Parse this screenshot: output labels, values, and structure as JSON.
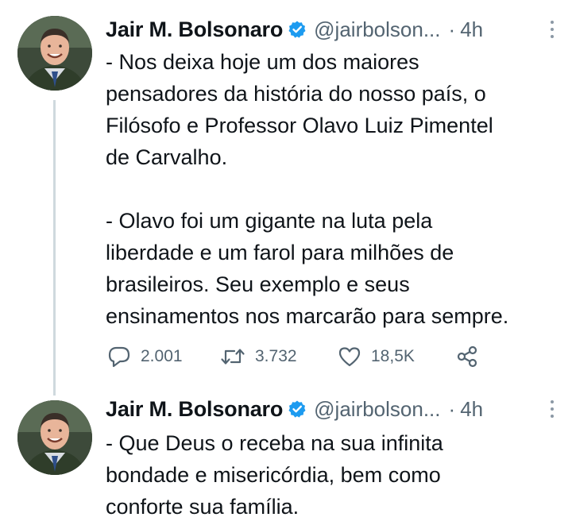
{
  "tweets": [
    {
      "display_name": "Jair M. Bolsonaro",
      "handle": "@jairbolson...",
      "separator": "·",
      "time": "4h",
      "paragraphs": [
        [
          "- Nos deixa hoje um dos maiores",
          "pensadores da história do nosso país, o",
          "Filósofo e Professor Olavo Luiz Pimentel",
          "de Carvalho."
        ],
        [
          "- Olavo foi um gigante na luta pela",
          "liberdade e um farol para milhões de",
          "brasileiros. Seu exemplo e seus",
          "ensinamentos nos marcarão para sempre."
        ]
      ],
      "actions": {
        "replies": "2.001",
        "retweets": "3.732",
        "likes": "18,5K"
      }
    },
    {
      "display_name": "Jair M. Bolsonaro",
      "handle": "@jairbolson...",
      "separator": "·",
      "time": "4h",
      "paragraphs": [
        [
          "- Que Deus o receba na sua infinita",
          "bondade e misericórdia, bem como",
          "conforte sua família."
        ]
      ]
    }
  ],
  "colors": {
    "text": "#0f1419",
    "secondary": "#536471",
    "verified": "#1d9bf0",
    "thread_line": "#cfd9de"
  },
  "icons": [
    "verified-badge-icon",
    "more-icon",
    "reply-icon",
    "retweet-icon",
    "like-icon",
    "share-icon"
  ]
}
